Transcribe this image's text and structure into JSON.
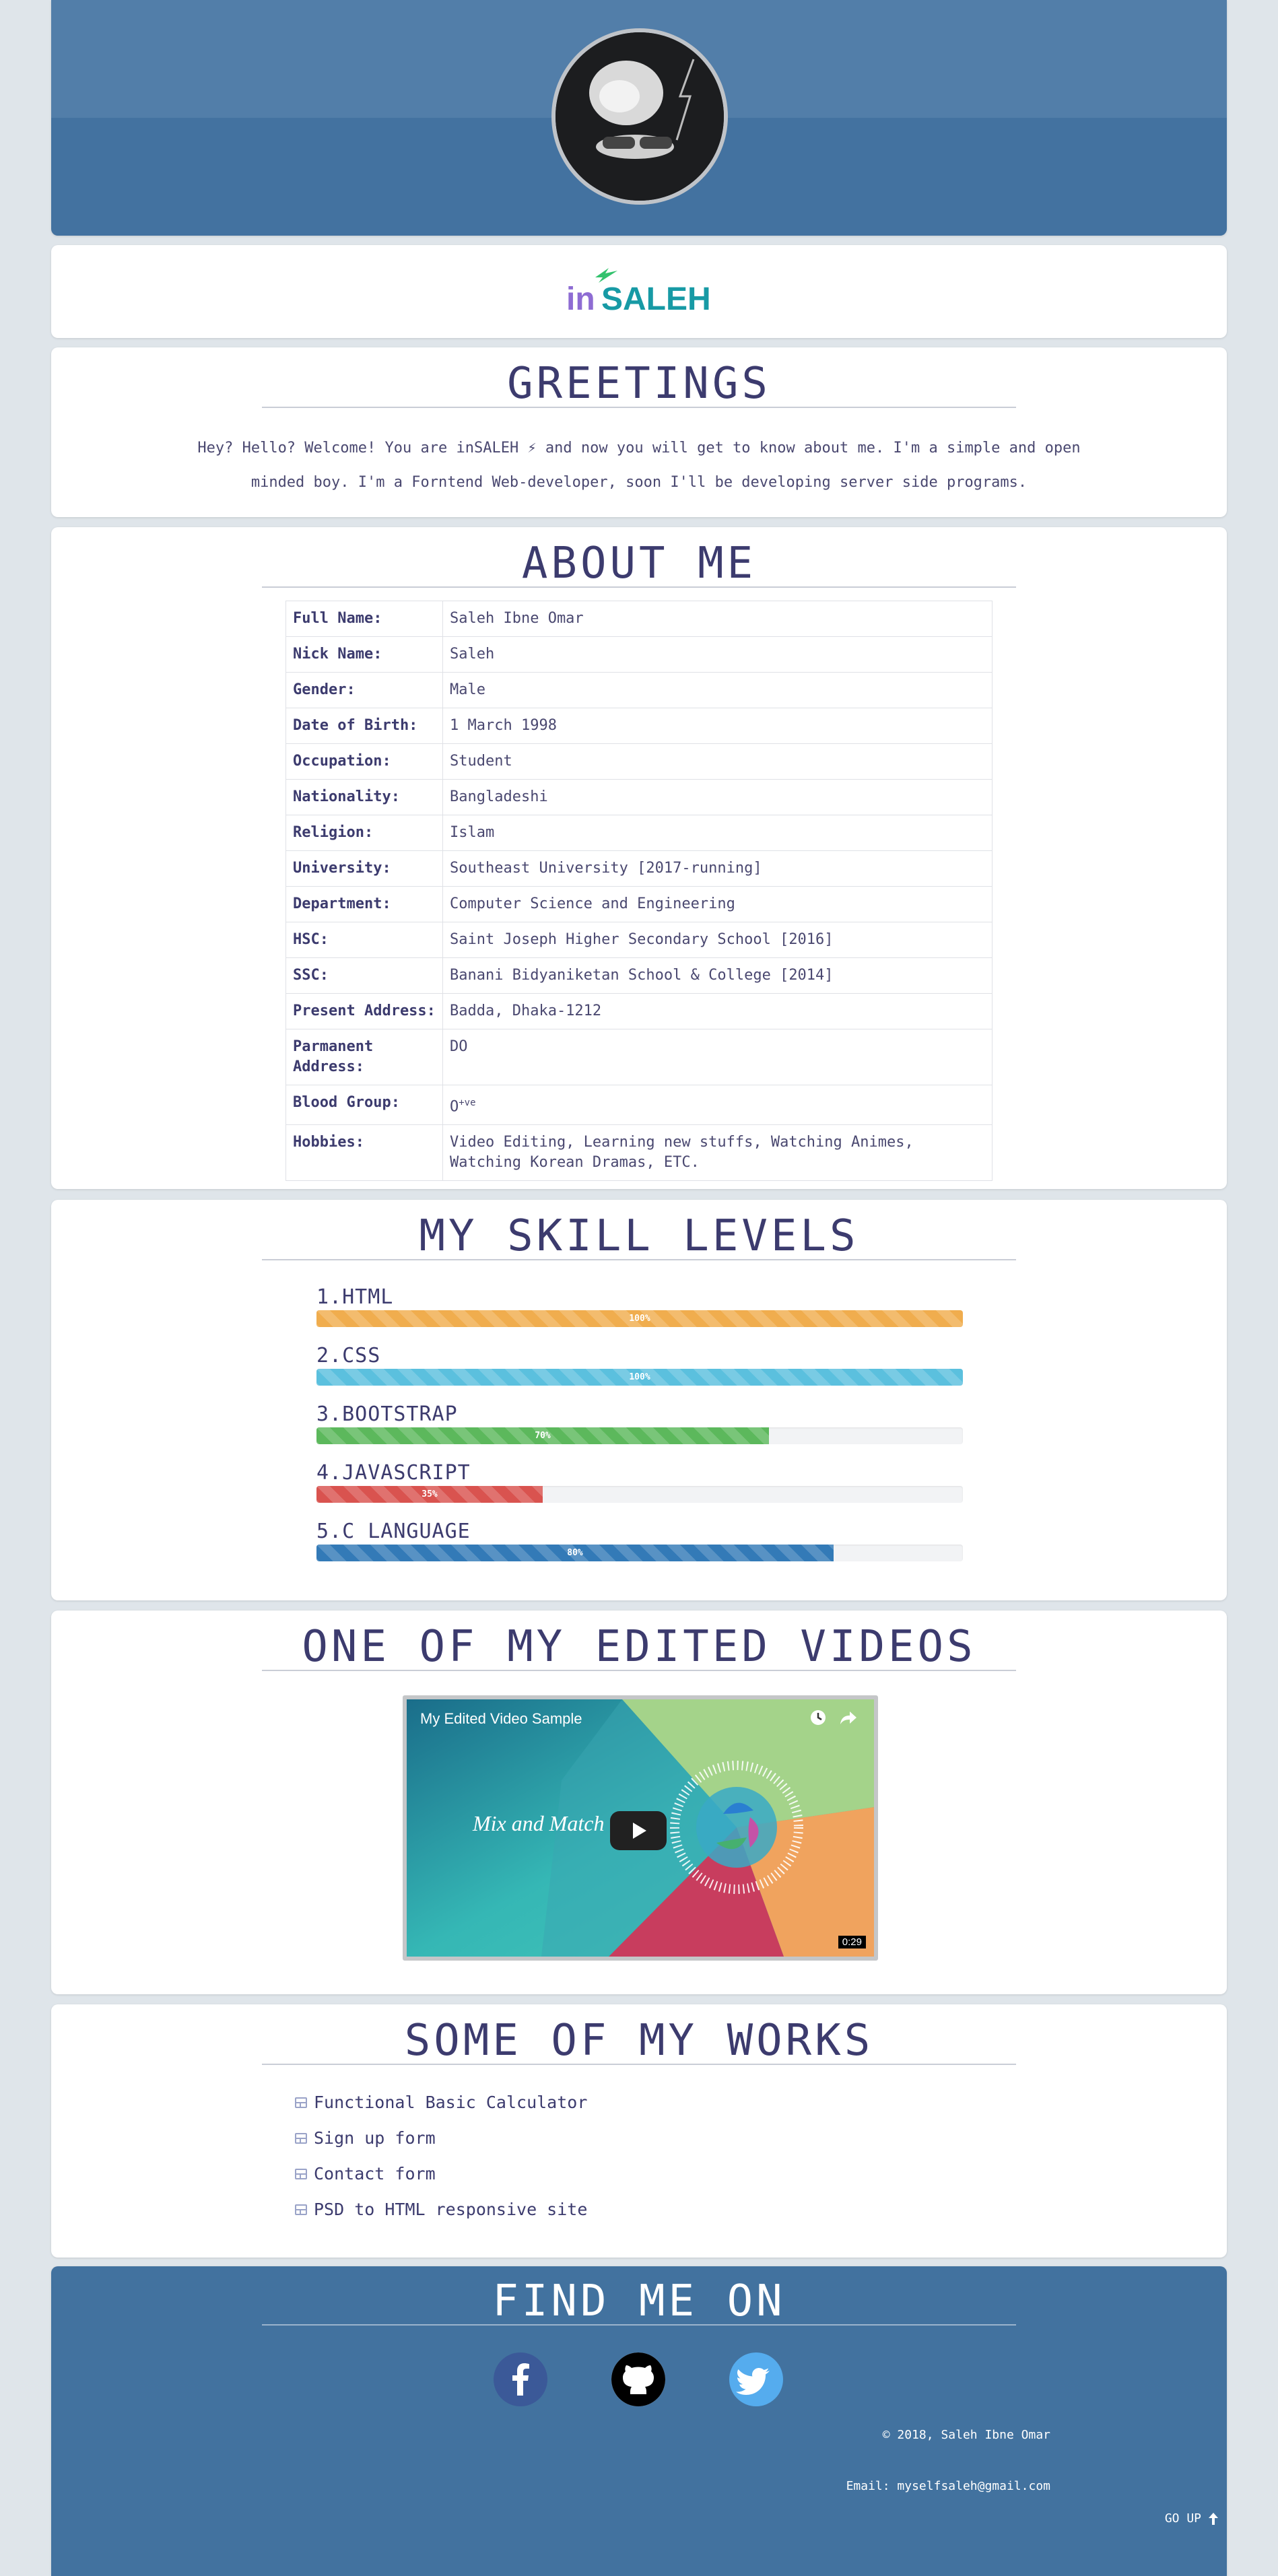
{
  "logo": {
    "prefix": "in",
    "suffix": "SALEH"
  },
  "greetings": {
    "title": "GREETINGS",
    "text": "Hey? Hello? Welcome! You are inSALEH ⚡ and now you will get to know about me. I'm a simple and open minded boy. I'm a Forntend Web-developer, soon I'll be developing server side programs."
  },
  "about": {
    "title": "ABOUT ME",
    "rows": [
      {
        "key": "Full Name:",
        "value": "Saleh Ibne Omar"
      },
      {
        "key": "Nick Name:",
        "value": "Saleh"
      },
      {
        "key": "Gender:",
        "value": "Male"
      },
      {
        "key": "Date of Birth:",
        "value": "1 March 1998"
      },
      {
        "key": "Occupation:",
        "value": "Student"
      },
      {
        "key": "Nationality:",
        "value": "Bangladeshi"
      },
      {
        "key": "Religion:",
        "value": "Islam"
      },
      {
        "key": "University:",
        "value": "Southeast University [2017-running]"
      },
      {
        "key": "Department:",
        "value": "Computer Science and Engineering"
      },
      {
        "key": "HSC:",
        "value": "Saint Joseph Higher Secondary School [2016]"
      },
      {
        "key": "SSC:",
        "value": "Banani Bidyaniketan School & College [2014]"
      },
      {
        "key": "Present Address:",
        "value": "Badda, Dhaka-1212"
      },
      {
        "key": "Parmanent Address:",
        "value": "DO"
      },
      {
        "key": "Blood Group:",
        "value": "O",
        "sup": "+ve"
      },
      {
        "key": "Hobbies:",
        "value": "Video Editing, Learning new stuffs, Watching Animes, Watching Korean Dramas, ETC."
      }
    ]
  },
  "skills": {
    "title": "MY SKILL LEVELS",
    "items": [
      {
        "label": "1.HTML",
        "percent": 100,
        "text": "100%",
        "color": "#f0ad4e"
      },
      {
        "label": "2.CSS",
        "percent": 100,
        "text": "100%",
        "color": "#5bc0de"
      },
      {
        "label": "3.BOOTSTRAP",
        "percent": 70,
        "text": "70%",
        "color": "#5cb85c"
      },
      {
        "label": "4.JAVASCRIPT",
        "percent": 35,
        "text": "35%",
        "color": "#d9534f"
      },
      {
        "label": "5.C LANGUAGE",
        "percent": 80,
        "text": "80%",
        "color": "#337ab7"
      }
    ]
  },
  "video": {
    "title": "ONE OF MY EDITED VIDEOS",
    "video_title": "My Edited Video Sample",
    "tagline": "Mix and Match",
    "duration": "0:29"
  },
  "works": {
    "title": "SOME OF MY WORKS",
    "items": [
      "Functional Basic Calculator",
      "Sign up form",
      "Contact form",
      "PSD to HTML responsive site"
    ]
  },
  "footer": {
    "title": "FIND ME ON",
    "copyright": "© 2018, Saleh Ibne Omar",
    "email": "Email: myselfsaleh@gmail.com",
    "go_up": "GO UP"
  },
  "colors": {
    "header_bg": "#4372a0",
    "text": "#3c3b6e",
    "logo_in": "#8e6cd3",
    "logo_saleh": "#179aa5",
    "facebook": "#3b5998",
    "twitter": "#55acee"
  },
  "icons": [
    "avatar",
    "lightning-icon",
    "clock-icon",
    "share-icon",
    "play-icon",
    "window-icon",
    "facebook-icon",
    "github-icon",
    "twitter-icon",
    "arrow-up-icon"
  ]
}
